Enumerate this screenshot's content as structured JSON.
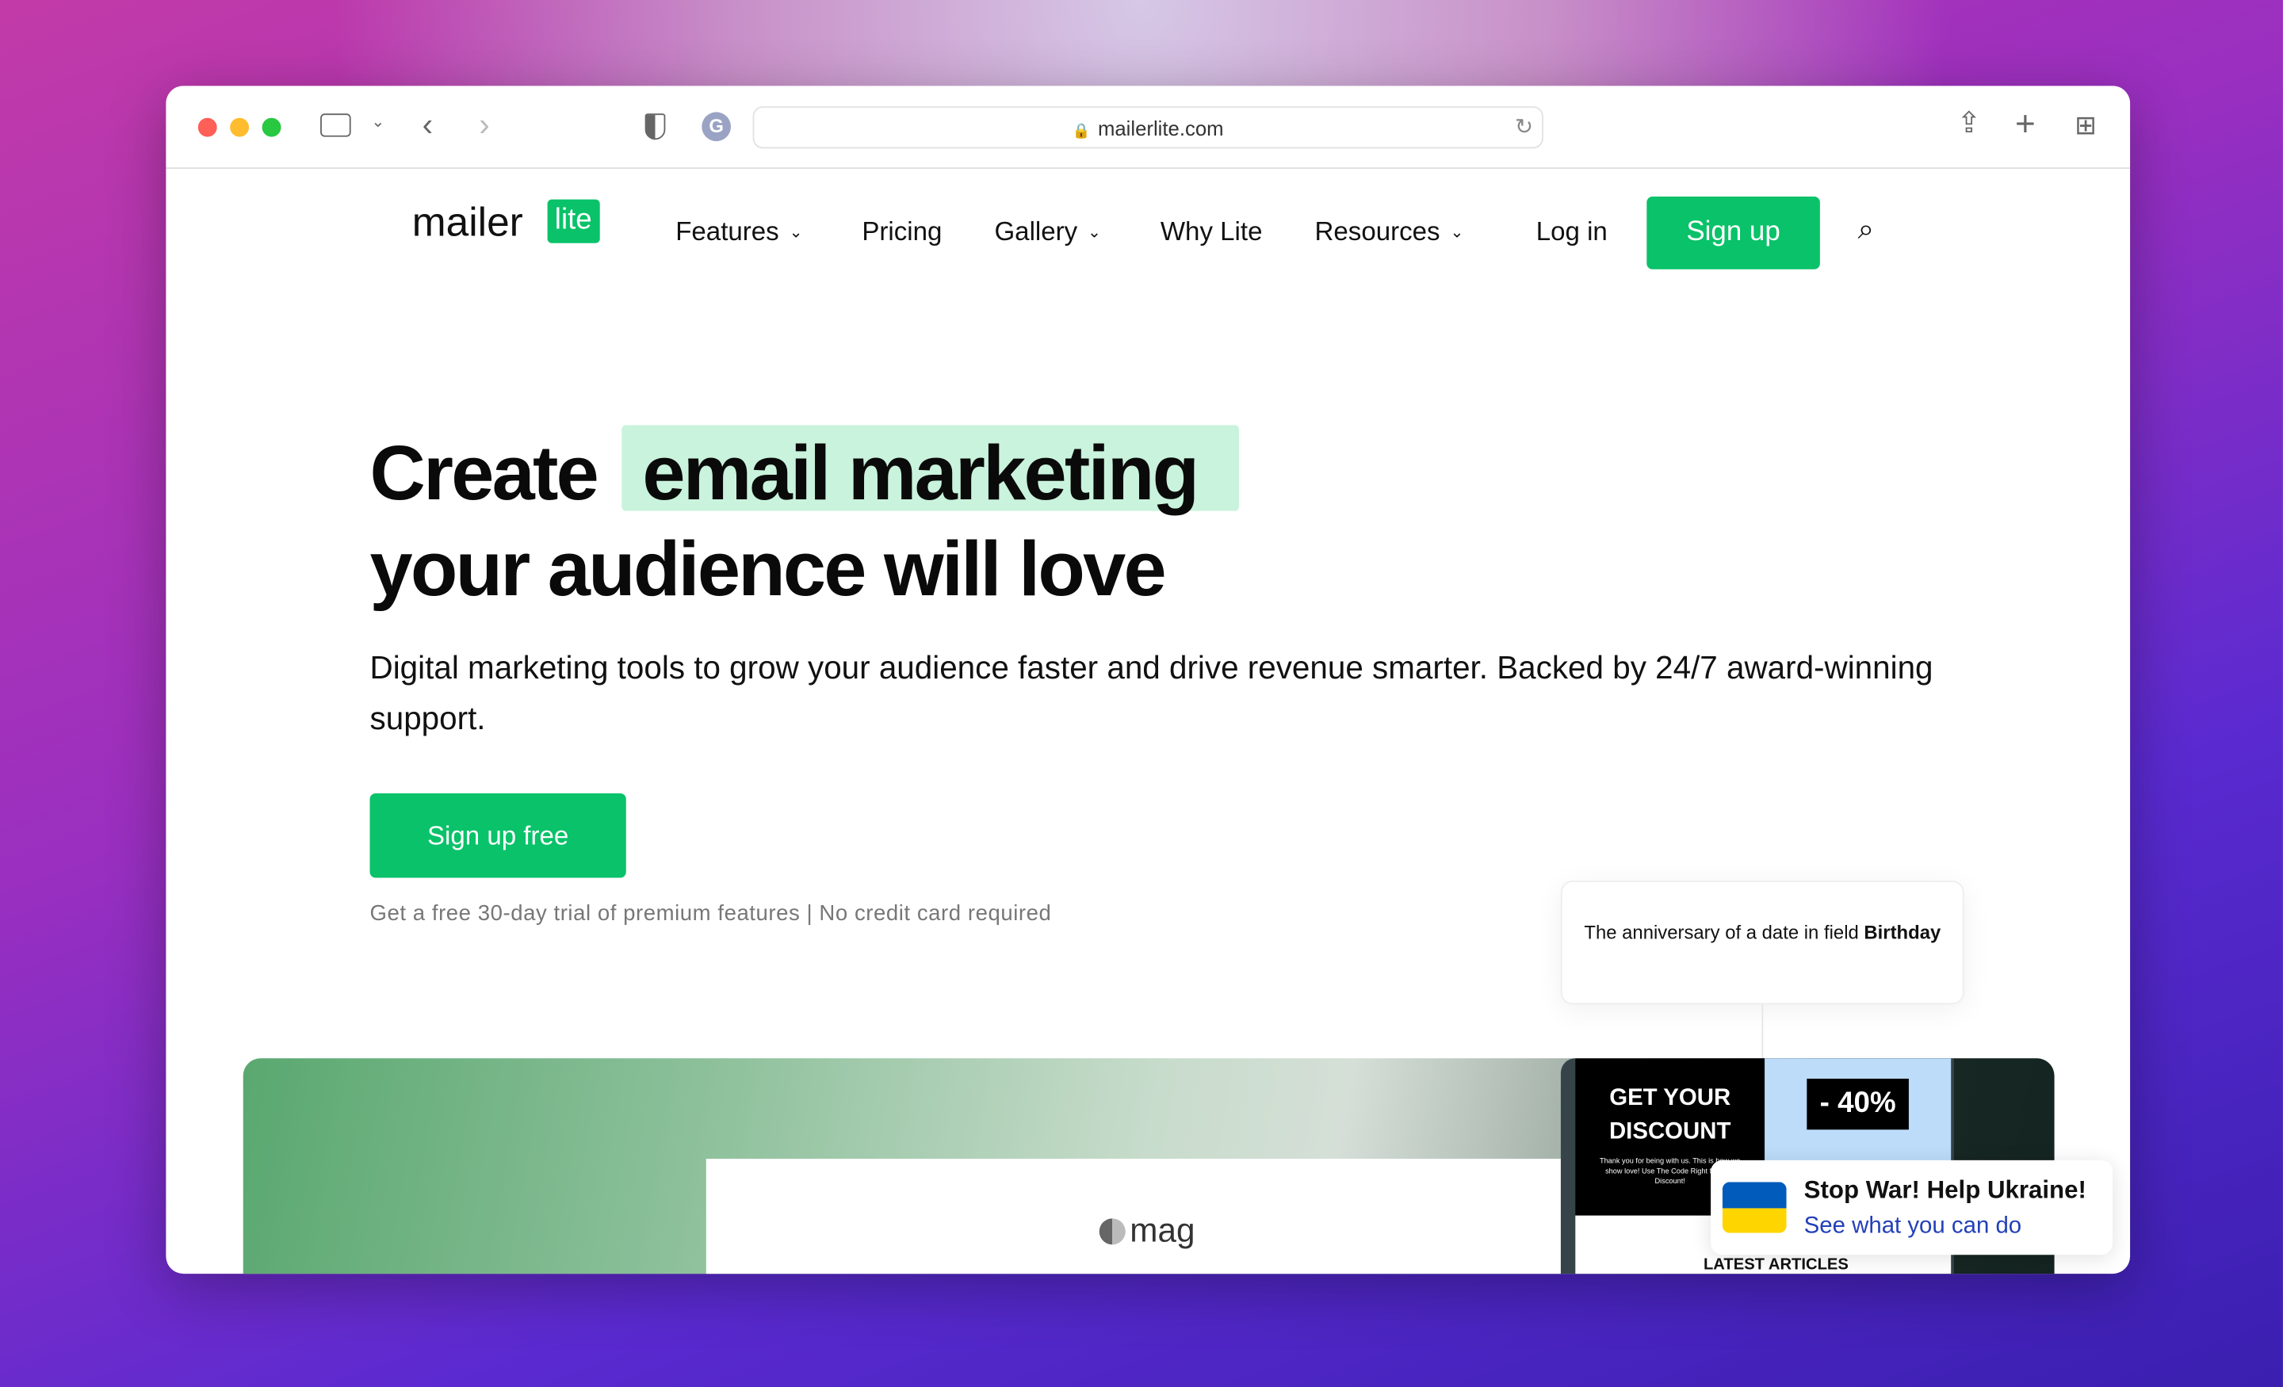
{
  "browser": {
    "url": "mailerlite.com"
  },
  "nav": {
    "logo_text": "mailer",
    "logo_badge": "lite",
    "items": [
      {
        "label": "Features",
        "dropdown": true
      },
      {
        "label": "Pricing",
        "dropdown": false
      },
      {
        "label": "Gallery",
        "dropdown": true
      },
      {
        "label": "Why Lite",
        "dropdown": false
      },
      {
        "label": "Resources",
        "dropdown": true
      }
    ],
    "login": "Log in",
    "signup": "Sign up"
  },
  "hero": {
    "title_pre": "Create",
    "title_highlight": "email marketing",
    "title_line2": "your audience will love",
    "subtitle": "Digital marketing tools to grow your audience faster and drive revenue smarter. Backed by 24/7 award-winning support.",
    "cta": "Sign up free",
    "note": "Get a free 30-day trial of premium features | No credit card required"
  },
  "automation_card": {
    "text": "The anniversary of a date in field ",
    "bold": "Birthday"
  },
  "preview": {
    "mag_logo": "mag",
    "email_heading_1": "GET YOUR",
    "email_heading_2": "DISCOUNT",
    "email_body": "Thank you for being with us. This is how we show love! Use The Code Right for Your Discount!",
    "discount": "- 40%",
    "latest": "LATEST ARTICLES"
  },
  "banner": {
    "title": "Stop War! Help Ukraine!",
    "link": "See what you can do"
  },
  "colors": {
    "brand": "#09c269",
    "highlight": "#c9f3dc",
    "link": "#2340b8",
    "flag_blue": "#005bbb",
    "flag_yellow": "#ffd500"
  }
}
